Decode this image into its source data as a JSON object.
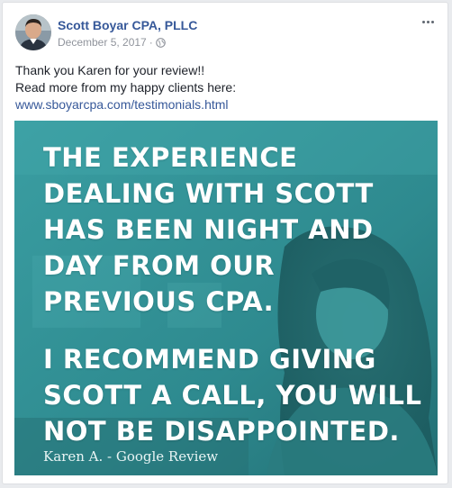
{
  "post": {
    "author": "Scott Boyar CPA, PLLC",
    "date": "December 5, 2017",
    "separator": "·",
    "audience_icon": "globe-icon",
    "more_icon": "more-options-icon",
    "text_lines": [
      "Thank you Karen for your review!!",
      "Read more from my happy clients here:"
    ],
    "link": "www.sboyarcpa.com/testimonials.html"
  },
  "image": {
    "quote_part1": [
      "THE EXPERIENCE",
      "DEALING WITH SCOTT",
      "HAS BEEN NIGHT AND",
      "DAY FROM OUR",
      "PREVIOUS CPA."
    ],
    "quote_part2": [
      "I RECOMMEND GIVING",
      "SCOTT A CALL, YOU WILL",
      "NOT BE DISAPPOINTED."
    ],
    "attribution": "Karen A. - Google Review",
    "overlay_color": "#2f8f94"
  },
  "colors": {
    "name": "#365899",
    "meta": "#90949c",
    "text": "#1d2129",
    "link": "#365899"
  }
}
